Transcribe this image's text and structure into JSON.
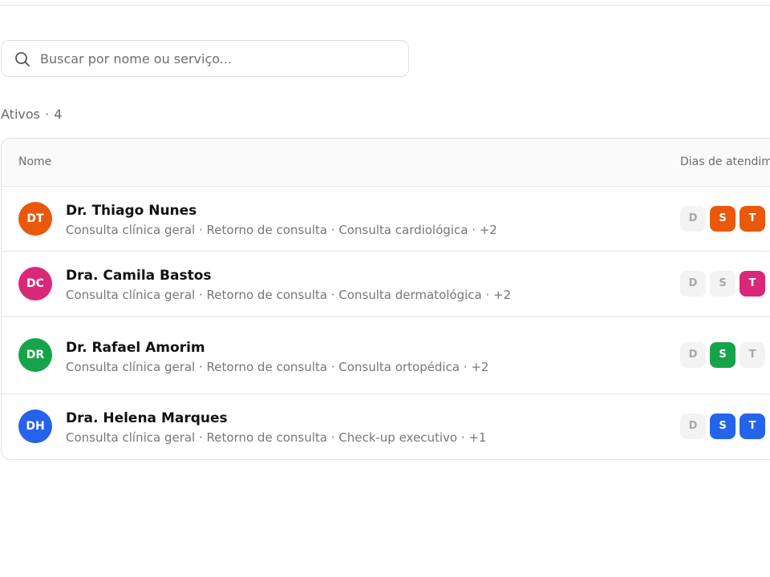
{
  "search": {
    "placeholder": "Buscar por nome ou serviço...",
    "value": ""
  },
  "section": {
    "label": "Ativos",
    "separator": "·",
    "count": "4"
  },
  "table": {
    "headers": {
      "name": "Nome",
      "days": "Dias de atendimento"
    },
    "rows": [
      {
        "initials": "DT",
        "name": "Dr. Thiago Nunes",
        "color": "#ea580c",
        "services": "Consulta clínica geral · Retorno de consulta · Consulta cardiológica · +2",
        "days": [
          {
            "label": "D",
            "active": false
          },
          {
            "label": "S",
            "active": true
          },
          {
            "label": "T",
            "active": true
          }
        ]
      },
      {
        "initials": "DC",
        "name": "Dra. Camila Bastos",
        "color": "#db2777",
        "services": "Consulta clínica geral · Retorno de consulta · Consulta dermatológica · +2",
        "days": [
          {
            "label": "D",
            "active": false
          },
          {
            "label": "S",
            "active": false
          },
          {
            "label": "T",
            "active": true
          }
        ]
      },
      {
        "initials": "DR",
        "name": "Dr. Rafael Amorim",
        "color": "#16a34a",
        "services": "Consulta clínica geral · Retorno de consulta · Consulta ortopédica · +2",
        "days": [
          {
            "label": "D",
            "active": false
          },
          {
            "label": "S",
            "active": true
          },
          {
            "label": "T",
            "active": false
          }
        ]
      },
      {
        "initials": "DH",
        "name": "Dra. Helena Marques",
        "color": "#2563eb",
        "services": "Consulta clínica geral · Retorno de consulta · Check-up executivo · +1",
        "days": [
          {
            "label": "D",
            "active": false
          },
          {
            "label": "S",
            "active": true
          },
          {
            "label": "T",
            "active": true
          }
        ]
      }
    ]
  },
  "icons": {
    "search": "search-icon"
  }
}
